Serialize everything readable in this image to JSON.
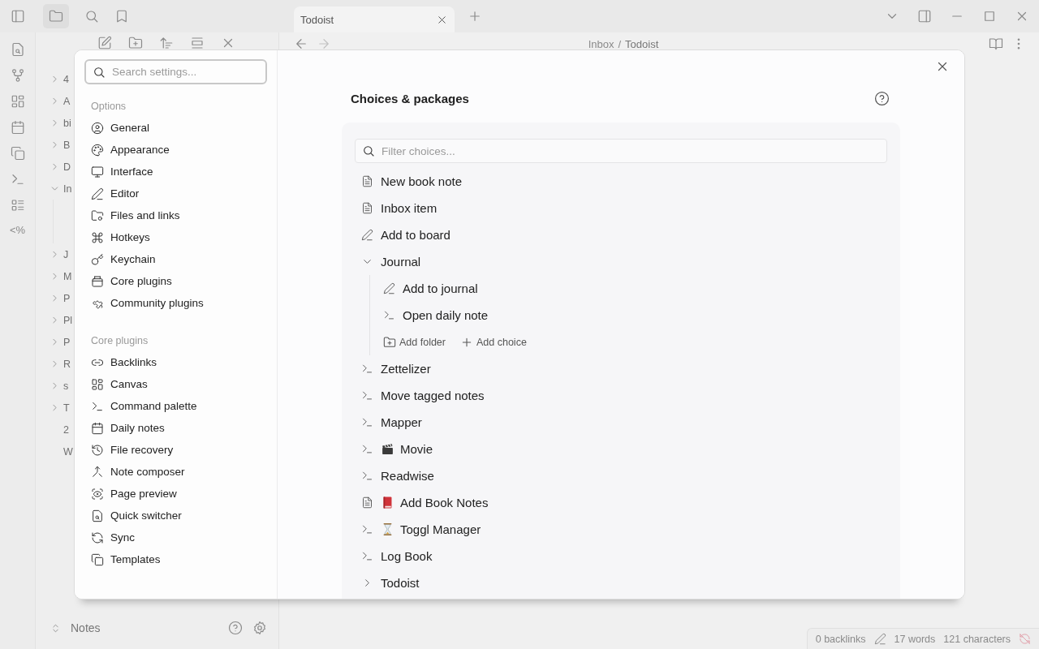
{
  "tabs": [
    {
      "label": "Todoist",
      "selected": true
    }
  ],
  "ribbon": {
    "template_glyph": "<%"
  },
  "breadcrumb": {
    "parent": "Inbox",
    "separator": "/",
    "current": "Todoist"
  },
  "file_tree": [
    {
      "label": "4",
      "kind": "folder",
      "expanded": false
    },
    {
      "label": "A",
      "kind": "folder",
      "expanded": false
    },
    {
      "label": "bi",
      "kind": "folder",
      "expanded": false
    },
    {
      "label": "B",
      "kind": "folder",
      "expanded": false
    },
    {
      "label": "D",
      "kind": "folder",
      "expanded": false
    },
    {
      "label": "In",
      "kind": "folder",
      "expanded": true
    },
    {
      "label": "J",
      "kind": "folder",
      "expanded": false
    },
    {
      "label": "M",
      "kind": "folder",
      "expanded": false
    },
    {
      "label": "P",
      "kind": "folder",
      "expanded": false
    },
    {
      "label": "Pl",
      "kind": "folder",
      "expanded": false
    },
    {
      "label": "P",
      "kind": "folder",
      "expanded": false
    },
    {
      "label": "R",
      "kind": "folder",
      "expanded": false
    },
    {
      "label": "s",
      "kind": "folder",
      "expanded": false
    },
    {
      "label": "T",
      "kind": "folder",
      "expanded": false
    },
    {
      "label": "2",
      "kind": "file"
    },
    {
      "label": "W",
      "kind": "file"
    }
  ],
  "vault": {
    "name": "Notes"
  },
  "status_bar": {
    "backlinks": "0 backlinks",
    "words": "17 words",
    "characters": "121 characters"
  },
  "settings": {
    "search_placeholder": "Search settings...",
    "sections": [
      {
        "heading": "Options",
        "items": [
          "General",
          "Appearance",
          "Interface",
          "Editor",
          "Files and links",
          "Hotkeys",
          "Keychain",
          "Core plugins",
          "Community plugins"
        ]
      },
      {
        "heading": "Core plugins",
        "items": [
          "Backlinks",
          "Canvas",
          "Command palette",
          "Daily notes",
          "File recovery",
          "Note composer",
          "Page preview",
          "Quick switcher",
          "Sync",
          "Templates"
        ]
      }
    ]
  },
  "choices": {
    "title": "Choices & packages",
    "filter_placeholder": "Filter choices...",
    "items": [
      {
        "label": "New book note",
        "kind": "file"
      },
      {
        "label": "Inbox item",
        "kind": "file"
      },
      {
        "label": "Add to board",
        "kind": "pencil"
      },
      {
        "label": "Journal",
        "kind": "folder",
        "expanded": true,
        "children": [
          {
            "label": "Add to journal",
            "kind": "pencil"
          },
          {
            "label": "Open daily note",
            "kind": "terminal"
          }
        ],
        "actions": [
          "Add folder",
          "Add choice"
        ]
      },
      {
        "label": "Zettelizer",
        "kind": "terminal"
      },
      {
        "label": "Move tagged notes",
        "kind": "terminal"
      },
      {
        "label": "Mapper",
        "kind": "terminal"
      },
      {
        "label": "Movie",
        "kind": "terminal"
      },
      {
        "label": "Readwise",
        "kind": "terminal"
      },
      {
        "label": "Add Book Notes",
        "kind": "file"
      },
      {
        "label": "Toggl Manager",
        "kind": "terminal"
      },
      {
        "label": "Log Book",
        "kind": "terminal"
      },
      {
        "label": "Todoist",
        "kind": "folder",
        "expanded": false
      }
    ]
  }
}
